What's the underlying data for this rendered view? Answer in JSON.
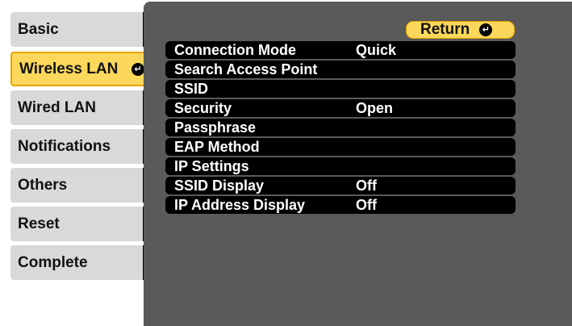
{
  "menu": {
    "items": [
      {
        "label": "Basic"
      },
      {
        "label": "Wireless LAN"
      },
      {
        "label": "Wired LAN"
      },
      {
        "label": "Notifications"
      },
      {
        "label": "Others"
      },
      {
        "label": "Reset"
      },
      {
        "label": "Complete"
      }
    ],
    "active_index": 1
  },
  "return_button": {
    "label": "Return"
  },
  "settings": [
    {
      "label": "Connection Mode",
      "value": "Quick"
    },
    {
      "label": "Search Access Point",
      "value": ""
    },
    {
      "label": "SSID",
      "value": ""
    },
    {
      "label": "Security",
      "value": "Open"
    },
    {
      "label": "Passphrase",
      "value": ""
    },
    {
      "label": "EAP Method",
      "value": ""
    },
    {
      "label": "IP Settings",
      "value": ""
    },
    {
      "label": "SSID Display",
      "value": "Off"
    },
    {
      "label": "IP Address Display",
      "value": "Off"
    }
  ],
  "colors": {
    "highlight": "#fbd85b",
    "highlight_border": "#e8a300",
    "panel": "#5a5a5a",
    "menu_bg": "#d9d9d9",
    "row_bg": "#000000"
  },
  "icons": {
    "enter": "enter-arrow-icon"
  }
}
